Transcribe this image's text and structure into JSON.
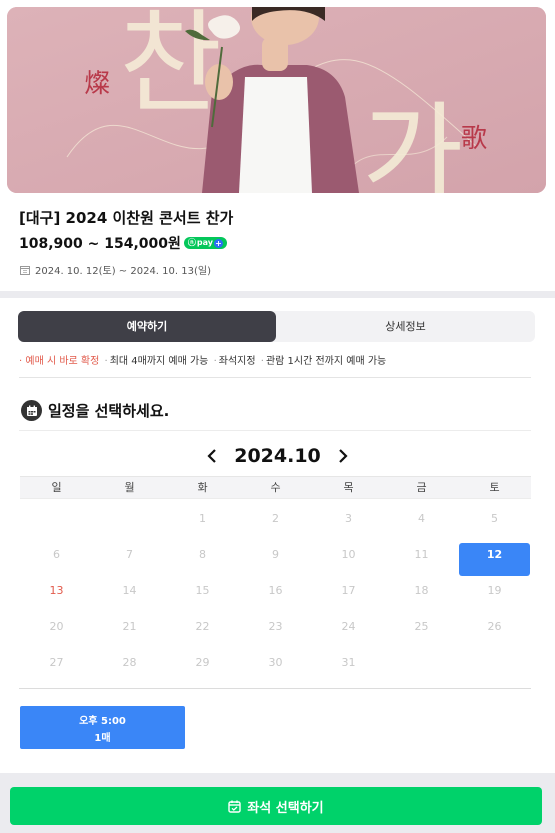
{
  "banner": {
    "hanja_left": "燦",
    "hanja_right": "歌",
    "hangul_top": "찬",
    "hangul_bottom": "가"
  },
  "event": {
    "title": "[대구] 2024 이찬원 콘서트 찬가",
    "price": "108,900 ~ 154,000원",
    "npay_label": "pay",
    "period": "2024. 10. 12(토) ~ 2024. 10. 13(일)"
  },
  "tabs": {
    "booking": "예약하기",
    "details": "상세정보"
  },
  "notice": {
    "instant": "예매 시 바로 확정",
    "items": [
      "최대 4매까지 예매 가능",
      "좌석지정",
      "관람 1시간 전까지 예매 가능"
    ]
  },
  "schedule": {
    "heading": "일정을 선택하세요."
  },
  "calendar": {
    "month_label": "2024.10",
    "weekdays": [
      "일",
      "월",
      "화",
      "수",
      "목",
      "금",
      "토"
    ],
    "weeks": [
      [
        "",
        "",
        "1",
        "2",
        "3",
        "4",
        "5"
      ],
      [
        "6",
        "7",
        "8",
        "9",
        "10",
        "11",
        "12"
      ],
      [
        "13",
        "14",
        "15",
        "16",
        "17",
        "18",
        "19"
      ],
      [
        "20",
        "21",
        "22",
        "23",
        "24",
        "25",
        "26"
      ],
      [
        "27",
        "28",
        "29",
        "30",
        "31",
        "",
        ""
      ]
    ],
    "selected_day": "12",
    "red_day": "13"
  },
  "time_slot": {
    "time": "오후 5:00",
    "remaining": "1매"
  },
  "cta": {
    "label": "좌석 선택하기"
  },
  "colors": {
    "accent_blue": "#3a86f7",
    "cta_green": "#00d26a",
    "notice_red": "#e25b4c",
    "tab_dark": "#3f3f47"
  }
}
